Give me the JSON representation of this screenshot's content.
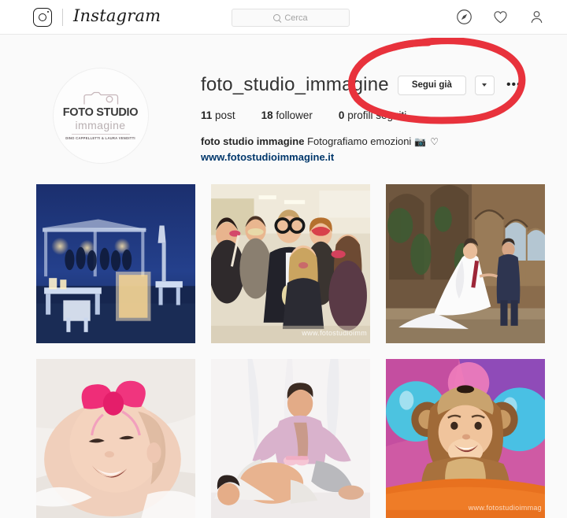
{
  "header": {
    "logo_icon": "instagram-camera-icon",
    "wordmark": "Instagram",
    "search": {
      "placeholder": "Cerca",
      "value": "",
      "icon": "search-icon"
    },
    "nav": [
      {
        "name": "explore-icon",
        "label": "Esplora"
      },
      {
        "name": "activity-heart-icon",
        "label": "Attività"
      },
      {
        "name": "profile-person-icon",
        "label": "Profilo"
      }
    ]
  },
  "profile": {
    "avatar": {
      "name": "profile-avatar",
      "logo_icon": "camera-outline-icon",
      "line1": "FOTO STUDIO",
      "line2": "immagine",
      "line3": "DINO CAPPELLETTI & LAURA VENDITTI"
    },
    "username": "foto_studio_immagine",
    "follow_button": "Segui già",
    "dropdown_icon": "chevron-down-icon",
    "more_button": "•••",
    "stats": [
      {
        "value": "11",
        "label": "post"
      },
      {
        "value": "18",
        "label": "follower"
      },
      {
        "value": "0",
        "label": "profili seguiti"
      }
    ],
    "bio": {
      "name": "foto studio immagine",
      "text": "Fotografiamo emozioni",
      "emoji": "📷 ♡",
      "website": "www.fotostudioimmagine.it"
    }
  },
  "grid": {
    "posts": [
      {
        "id": "post-1",
        "alt": "Ricevimento di matrimonio in spiaggia al crepuscolo con tavoli illuminati",
        "watermark": ""
      },
      {
        "id": "post-2",
        "alt": "Gruppo di invitati al photo booth con occhiali e maschere di carta",
        "watermark": "www.fotostudioimm"
      },
      {
        "id": "post-3",
        "alt": "Sposi che camminano tra le rovine di un chiostro in pietra",
        "watermark": ""
      },
      {
        "id": "post-4",
        "alt": "Neonata sorridente con fiocco rosa tra i capelli",
        "watermark": ""
      },
      {
        "id": "post-5",
        "alt": "Servizio fotografico di maternità in studio con scarpine rosa",
        "watermark": ""
      },
      {
        "id": "post-6",
        "alt": "Bambino vestito da scimmietta con palloncini colorati",
        "watermark": "www.fotostudioimmag"
      }
    ]
  },
  "annotation": {
    "name": "red-ellipse-highlight",
    "target": "Segui già",
    "color": "#e8323c"
  }
}
